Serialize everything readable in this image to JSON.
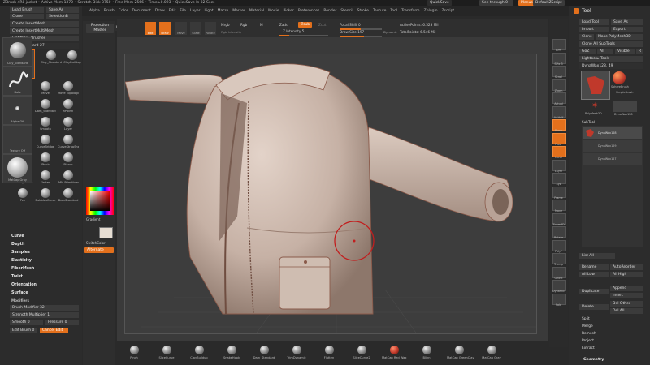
{
  "title": {
    "text": "ZBrush 4R8   jacket   • Active Mem 1370 • Scratch Disk 3750 • Free Mem 2566 • Timer▸0.093 • QuickSave In 32 Secs"
  },
  "menus": [
    "Alpha",
    "Brush",
    "Color",
    "Document",
    "Draw",
    "Edit",
    "File",
    "Layer",
    "Light",
    "Macro",
    "Marker",
    "Material",
    "Movie",
    "Picker",
    "Preferences",
    "Render",
    "Stencil",
    "Stroke",
    "Texture",
    "Tool",
    "Transform",
    "Zplugin",
    "Zscript"
  ],
  "topright": {
    "quicksave": "QuickSave",
    "seethrough": "See-through  0",
    "menus": "Menus",
    "script": "DefaultZScript"
  },
  "left": {
    "buttons": [
      "Load Brush",
      "Save As",
      "Clone",
      "SelectionB",
      "Create InsertMesh",
      "Create InsertMultiMesh",
      "Lightbox▸ Brushes"
    ],
    "current_brush": "Clay_Standard 27",
    "brushes": [
      "Clay_Standard",
      "ClayBuildup",
      "Inflat",
      "Move",
      "Move Topological",
      "Standard",
      "Dam_Standard",
      "hPolish",
      "SnakeHook",
      "Smooth",
      "Layer",
      "ZRemesher",
      "CurveBridge",
      "CurveStrapSnap",
      "Topology",
      "Pinch",
      "Planar",
      "Trim Dynamic",
      "Flatten",
      "IMM Primitives",
      "Pen",
      "BubblesCurve",
      "DamStandard",
      "MeshInsert"
    ],
    "sections": [
      "Curve",
      "Depth",
      "Samples",
      "Elasticity",
      "FiberMesh",
      "Twist",
      "Orientation",
      "Surface",
      "Modifiers"
    ],
    "modifiers": {
      "brush_modifier": "Brush Modifier 32",
      "strength": "Strength Multiplier 1",
      "smooth": "Smooth 0",
      "pressure": "Pressure 0",
      "edit_brush": "Edit Brush 0",
      "cancel": "Cancel Edit"
    }
  },
  "toolstrip": {
    "projection": "Projection Master",
    "lightbox": "LightBox",
    "tiles": [
      "Clay_Standard",
      "Dots",
      "Alpha Off",
      "Texture Off",
      "MatCap Gray"
    ],
    "gradient": "Gradient",
    "switchcolor": "SwitchColor",
    "alternate": "Alternate"
  },
  "topstrip": {
    "edit": "Edit",
    "draw": "Draw",
    "move": "Move",
    "scale": "Scale",
    "rotate": "Rotate",
    "mrgb": "Mrgb",
    "rgb": "Rgb",
    "m": "M",
    "rgb_intensity": "Rgb Intensity",
    "zadd": "Zadd",
    "zsub": "Zsub",
    "zcut": "Zcut",
    "z_intensity": "Z Intensity 5",
    "focal": "Focal Shift 0",
    "drawsize": "Draw Size 197",
    "dynamic": "Dynamic",
    "active_points": "ActivePoints: 6.523  Mil",
    "total_points": "TotalPoints: 6.546  Mil"
  },
  "rightstrip": [
    "BPR",
    "SPix 3",
    "Scroll",
    "Zoom",
    "Actual",
    "AAHalf",
    "Persp",
    "Floor",
    "Local",
    "LSym",
    "Xyz",
    "Frame",
    "Move",
    "Zoom3D",
    "Rotate",
    "PolyF",
    "Transp",
    "Ghost",
    "Dynamic",
    "Solo"
  ],
  "right": {
    "title": "Tool",
    "buttons": [
      "Load Tool",
      "Save As",
      "Import",
      "Export",
      "Clone",
      "Make PolyMesh3D",
      "GoZ",
      "All",
      "Visible",
      "R",
      "Lightbox▸ Tools"
    ],
    "current_tool": "DynaWax128. 49",
    "tools": [
      "DynaWax128",
      "SphereBrush",
      "SimpleBrush",
      "PolyMesh3D",
      "DynaWax128"
    ],
    "subtool_label": "SubTool",
    "subtools": [
      "DynaWax128",
      "DynaWax129",
      "DynaWax127"
    ],
    "list_all": "List All",
    "rename": "Rename",
    "autoreorder": "AutoReorder",
    "all_low": "All Low",
    "all_high": "All High",
    "duplicate": "Duplicate",
    "append": "Append",
    "insert": "Insert",
    "delete": "Delete",
    "del_other": "Del Other",
    "del_all": "Del All",
    "split": "Split",
    "merge": "Merge",
    "remesh": "Remesh",
    "project": "Project",
    "extract": "Extract",
    "geometry": "Geometry"
  },
  "bottom": [
    "Pinch",
    "SliceCurve",
    "ClayBuildup",
    "SnakeHook",
    "Dam_Standard",
    "TrimDynamic",
    "Flatten",
    "SliceCurve2",
    "MatCap Red Wax",
    "Blinn",
    "MatCap GreenClay",
    "MatCap Gray"
  ],
  "colors": {
    "accent": "#e3701c",
    "sculpt": "#cdb8ad",
    "brush_ring": "#c21e1e"
  }
}
